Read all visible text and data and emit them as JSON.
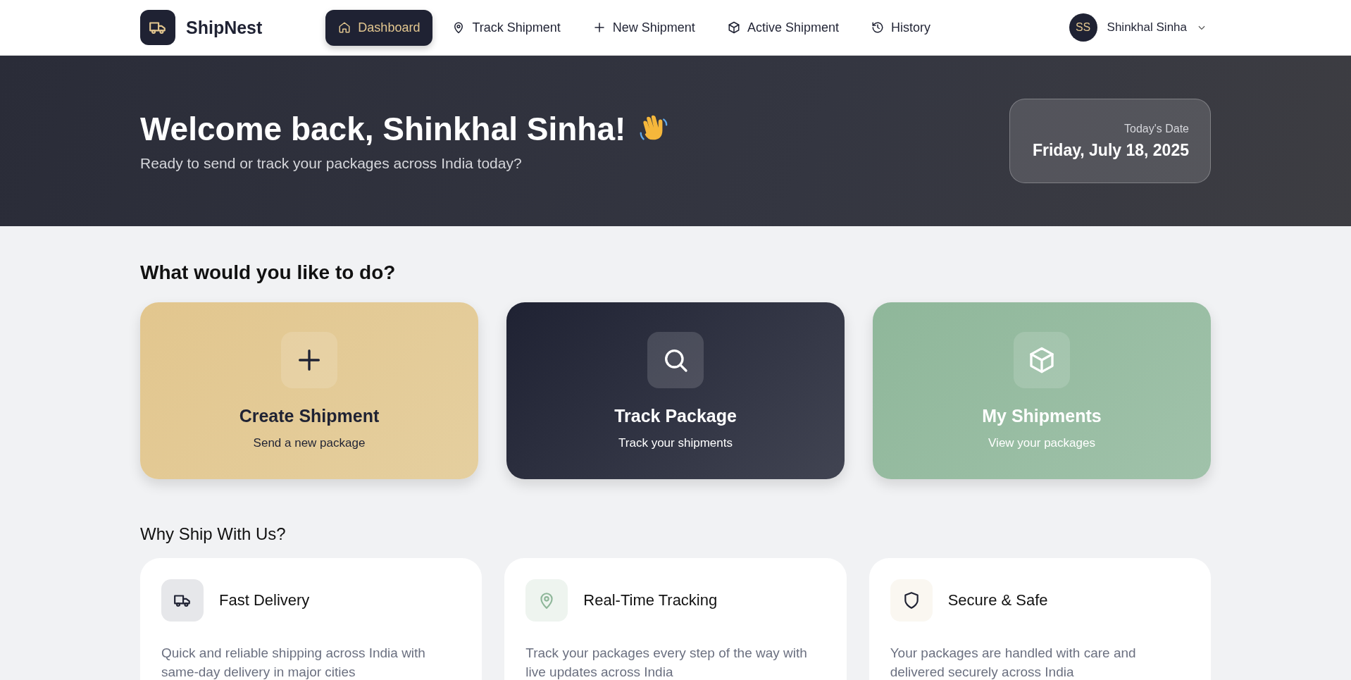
{
  "nav": {
    "brand": "ShipNest",
    "items": [
      {
        "label": "Dashboard",
        "selected": true
      },
      {
        "label": "Track Shipment",
        "selected": false
      },
      {
        "label": "New Shipment",
        "selected": false
      },
      {
        "label": "Active Shipment",
        "selected": false
      },
      {
        "label": "History",
        "selected": false
      }
    ],
    "user": {
      "initials": "SS",
      "name": "Shinkhal Sinha"
    }
  },
  "hero": {
    "title": "Welcome back, Shinkhal Sinha!",
    "subtitle": "Ready to send or track your packages across India today?",
    "date_label": "Today's Date",
    "date": "Friday, July 18, 2025"
  },
  "actions": {
    "heading": "What would you like to do?",
    "cards": [
      {
        "kind": "gold",
        "title": "Create Shipment",
        "subtitle": "Send a new package"
      },
      {
        "kind": "dark",
        "title": "Track Package",
        "subtitle": "Track your shipments"
      },
      {
        "kind": "green",
        "title": "My Shipments",
        "subtitle": "View your packages"
      }
    ]
  },
  "features": {
    "heading": "Why Ship With Us?",
    "cards": [
      {
        "title": "Fast Delivery",
        "text": "Quick and reliable shipping across India with same-day delivery in major cities"
      },
      {
        "title": "Real-Time Tracking",
        "text": "Track your packages every step of the way with live updates across India"
      },
      {
        "title": "Secure & Safe",
        "text": "Your packages are handled with care and delivered securely across India"
      }
    ]
  }
}
